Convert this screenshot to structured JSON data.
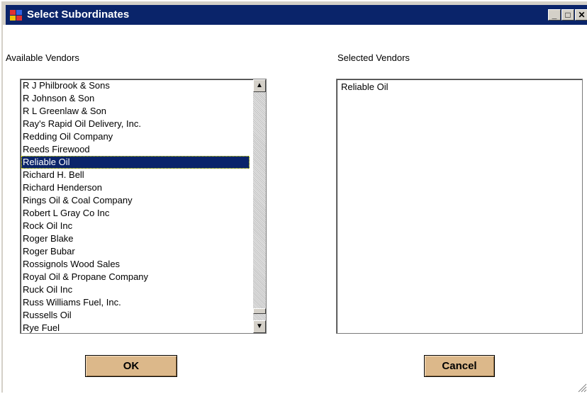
{
  "window": {
    "title": "Select Subordinates",
    "icon": "app-form-icon",
    "controls": {
      "minimize": "_",
      "maximize": "□",
      "close": "✕"
    }
  },
  "available": {
    "label": "Available Vendors",
    "items": [
      "R J Philbrook & Sons",
      "R Johnson & Son",
      "R L Greenlaw & Son",
      "Ray's Rapid Oil Delivery, Inc.",
      "Redding Oil Company",
      "Reeds Firewood",
      "Reliable Oil",
      "Richard H. Bell",
      "Richard Henderson",
      "Rings Oil & Coal Company",
      "Robert L Gray Co Inc",
      "Rock Oil Inc",
      "Roger Blake",
      "Roger Bubar",
      "Rossignols Wood Sales",
      "Royal Oil & Propane Company",
      "Ruck Oil Inc",
      "Russ Williams Fuel, Inc.",
      "Russells Oil",
      "Rye Fuel"
    ],
    "selected_index": 6,
    "scroll_position": 0.97
  },
  "selected": {
    "label": "Selected Vendors",
    "items": [
      "Reliable Oil"
    ]
  },
  "buttons": {
    "ok": "OK",
    "cancel": "Cancel"
  },
  "colors": {
    "titlebar": "#0a246a",
    "button": "#dcb88a",
    "selection": "#0a246a"
  }
}
